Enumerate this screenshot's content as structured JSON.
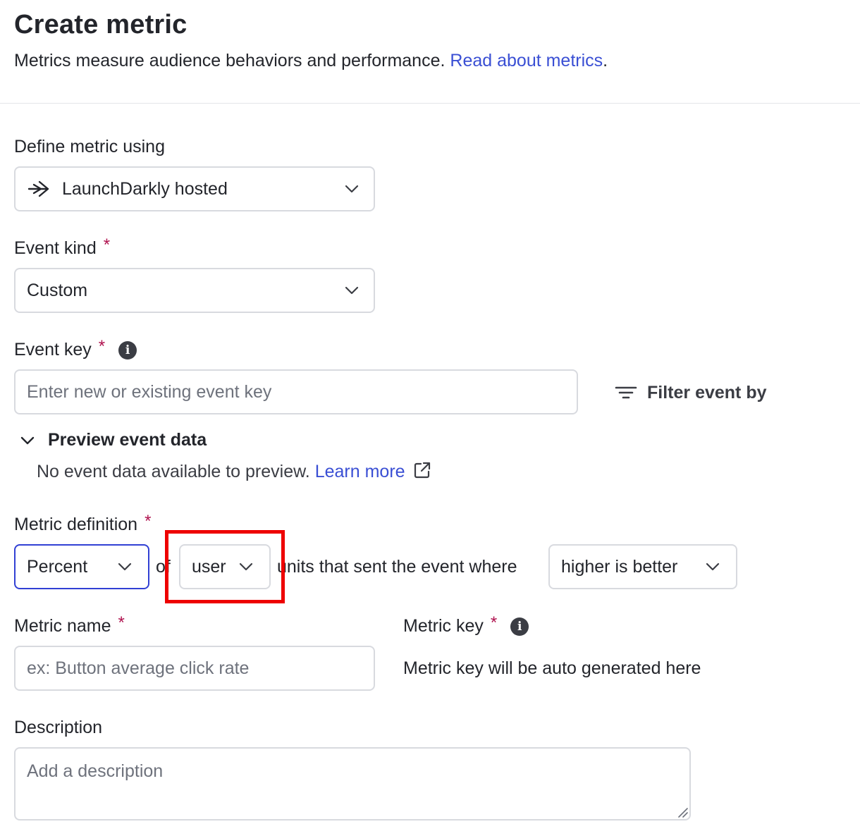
{
  "header": {
    "title": "Create metric",
    "subtitle": "Metrics measure audience behaviors and performance.",
    "link": "Read about metrics",
    "link_suffix": "."
  },
  "define": {
    "label": "Define metric using",
    "value": "LaunchDarkly hosted",
    "icon": "launchdarkly-arrow-icon"
  },
  "event_kind": {
    "label": "Event kind",
    "required": "*",
    "value": "Custom"
  },
  "event_key": {
    "label": "Event key",
    "required": "*",
    "info": "i",
    "placeholder": "Enter new or existing event key",
    "filter_label": "Filter event by"
  },
  "preview": {
    "label": "Preview event data",
    "text": "No event data available to preview.",
    "link": "Learn more"
  },
  "metric_definition": {
    "label": "Metric definition",
    "required": "*",
    "measure": "Percent",
    "of": "of",
    "unit": "user",
    "middle_text": "units that sent the event where",
    "direction": "higher is better"
  },
  "metric_name": {
    "label": "Metric name",
    "required": "*",
    "placeholder": "ex: Button average click rate"
  },
  "metric_key": {
    "label": "Metric key",
    "required": "*",
    "info": "i",
    "placeholder": "Metric key will be auto generated here"
  },
  "description": {
    "label": "Description",
    "placeholder": "Add a description"
  },
  "colors": {
    "link": "#3a4fd4",
    "required": "#b0134f",
    "focus": "#3140d4",
    "highlight": "#ee0000"
  }
}
